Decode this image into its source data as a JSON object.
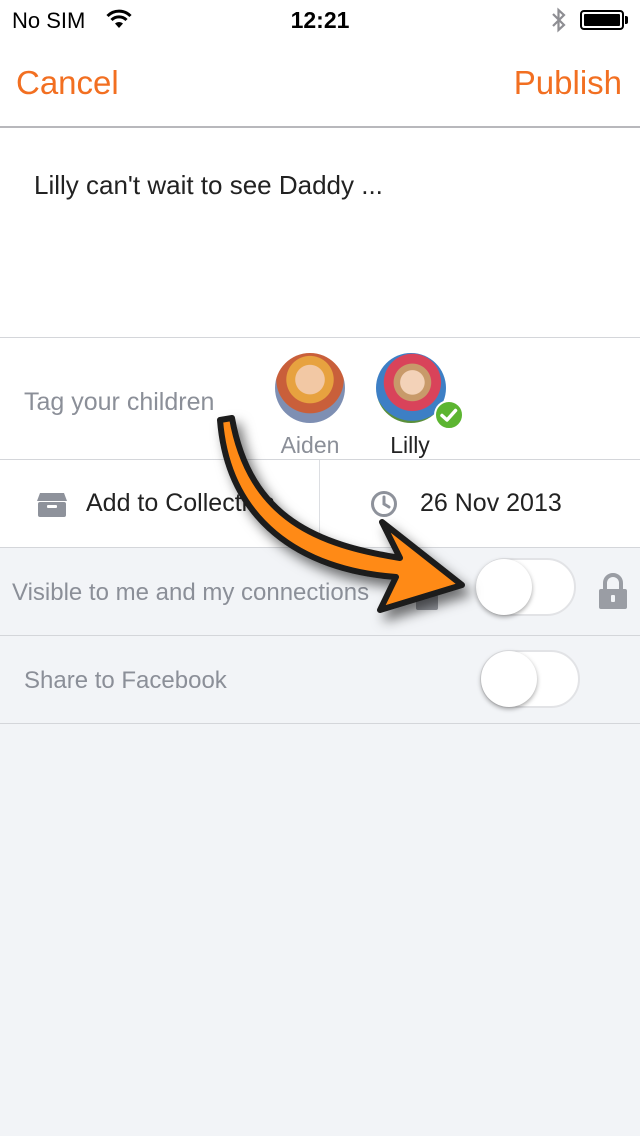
{
  "status_bar": {
    "carrier": "No SIM",
    "time": "12:21",
    "wifi_icon": "wifi-icon",
    "bluetooth_icon": "bluetooth-icon",
    "battery_icon": "battery-icon"
  },
  "nav": {
    "cancel_label": "Cancel",
    "publish_label": "Publish",
    "accent_color": "#f26f21"
  },
  "composer": {
    "text": "Lilly can't wait to see Daddy ..."
  },
  "tag": {
    "label": "Tag your children",
    "children": [
      {
        "name": "Aiden",
        "selected": false
      },
      {
        "name": "Lilly",
        "selected": true
      }
    ]
  },
  "collection": {
    "label": "Add to Collection",
    "icon": "box-icon"
  },
  "date": {
    "label": "26 Nov 2013",
    "icon": "clock-icon"
  },
  "visibility": {
    "label": "Visible to me and my connections",
    "toggle_on": false,
    "lock_icon": "lock-icon"
  },
  "facebook": {
    "label": "Share to Facebook",
    "toggle_on": false
  },
  "overlay": {
    "arrow_icon": "orange-arrow-icon",
    "arrow_color": "#ff8a14"
  }
}
